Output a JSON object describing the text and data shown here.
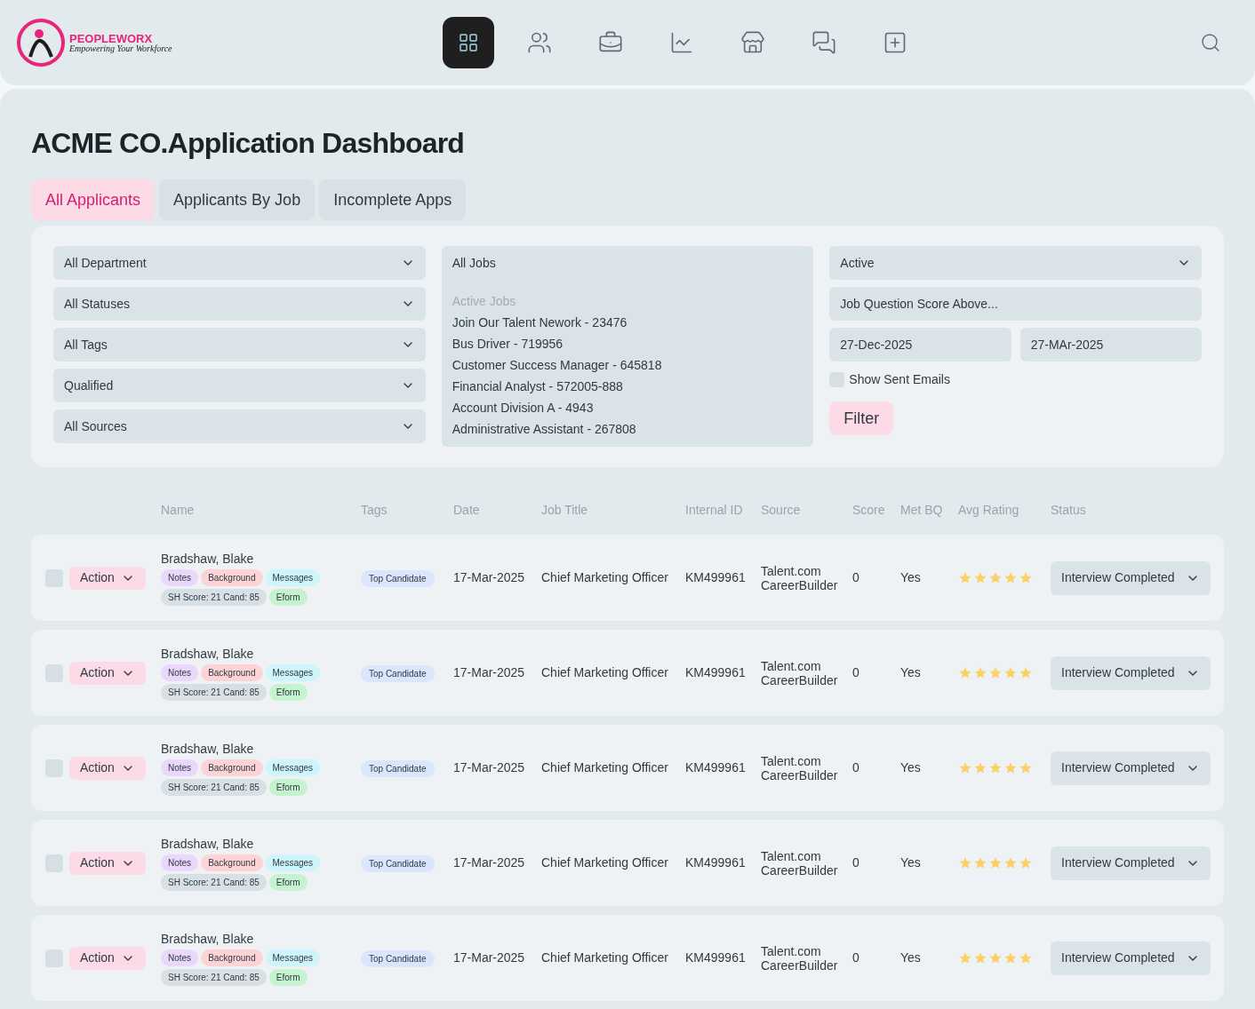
{
  "logo": {
    "name": "PEOPLEWORX",
    "tagline": "Empowering Your Workforce"
  },
  "nav": [
    {
      "kind": "grid",
      "selected": true
    },
    {
      "kind": "users",
      "selected": false
    },
    {
      "kind": "briefcase",
      "selected": false
    },
    {
      "kind": "chart",
      "selected": false
    },
    {
      "kind": "store",
      "selected": false
    },
    {
      "kind": "messages",
      "selected": false
    },
    {
      "kind": "add",
      "selected": false
    }
  ],
  "title": "ACME CO.Application Dashboard",
  "tabs": [
    {
      "label": "All Applicants",
      "selected": true
    },
    {
      "label": "Applicants By Job",
      "selected": false
    },
    {
      "label": "Incomplete Apps",
      "selected": false
    }
  ],
  "filters": {
    "selects": [
      "All Department",
      "All Statuses",
      "All Tags",
      "Qualified",
      "All Sources"
    ],
    "jobs": {
      "value": "All Jobs",
      "group_label": "Active Jobs",
      "options": [
        "Join Our Talent Nework - 23476",
        "Bus Driver - 719956",
        "Customer Success Manager - 645818",
        "Financial Analyst - 572005-888",
        "Account Division A - 4943",
        "Administrative Assistant - 267808"
      ]
    },
    "status": "Active",
    "score_placeholder": "Job Question Score Above...",
    "date_from": "27-Dec-2025",
    "date_to": "27-MAr-2025",
    "show_sent_emails": {
      "label": "Show Sent Emails",
      "checked": false
    },
    "filter_button": "Filter"
  },
  "table": {
    "columns": [
      "Name",
      "Tags",
      "Date",
      "Job Title",
      "Internal ID",
      "Source",
      "Score",
      "Met BQ",
      "Avg Rating",
      "Status"
    ],
    "rows": [
      {
        "checked": false,
        "action": "Action",
        "name": "Bradshaw, Blake",
        "chips": [
          {
            "label": "Notes",
            "color": "#ead7fb"
          },
          {
            "label": "Background",
            "color": "#fed3d6"
          },
          {
            "label": "Messages",
            "color": "#cdf5fb"
          },
          {
            "label": "SH Score: 21 Cand: 85",
            "color": "#d8e0e6"
          },
          {
            "label": "Eform",
            "color": "#c6f3cf"
          }
        ],
        "tag": "Top Candidate",
        "date": "17-Mar-2025",
        "job_title": "Chief Marketing Officer",
        "internal_id": "KM499961",
        "source": [
          "Talent.com",
          "CareerBuilder"
        ],
        "score": "0",
        "met_bq": "Yes",
        "stars": 5,
        "status": "Interview Completed"
      },
      {
        "checked": false,
        "action": "Action",
        "name": "Bradshaw, Blake",
        "chips": [
          {
            "label": "Notes",
            "color": "#ead7fb"
          },
          {
            "label": "Background",
            "color": "#fed3d6"
          },
          {
            "label": "Messages",
            "color": "#cdf5fb"
          },
          {
            "label": "SH Score: 21 Cand: 85",
            "color": "#d8e0e6"
          },
          {
            "label": "Eform",
            "color": "#c6f3cf"
          }
        ],
        "tag": "Top Candidate",
        "date": "17-Mar-2025",
        "job_title": "Chief Marketing Officer",
        "internal_id": "KM499961",
        "source": [
          "Talent.com",
          "CareerBuilder"
        ],
        "score": "0",
        "met_bq": "Yes",
        "stars": 5,
        "status": "Interview Completed"
      },
      {
        "checked": false,
        "action": "Action",
        "name": "Bradshaw, Blake",
        "chips": [
          {
            "label": "Notes",
            "color": "#ead7fb"
          },
          {
            "label": "Background",
            "color": "#fed3d6"
          },
          {
            "label": "Messages",
            "color": "#cdf5fb"
          },
          {
            "label": "SH Score: 21 Cand: 85",
            "color": "#d8e0e6"
          },
          {
            "label": "Eform",
            "color": "#c6f3cf"
          }
        ],
        "tag": "Top Candidate",
        "date": "17-Mar-2025",
        "job_title": "Chief Marketing Officer",
        "internal_id": "KM499961",
        "source": [
          "Talent.com",
          "CareerBuilder"
        ],
        "score": "0",
        "met_bq": "Yes",
        "stars": 5,
        "status": "Interview Completed"
      },
      {
        "checked": false,
        "action": "Action",
        "name": "Bradshaw, Blake",
        "chips": [
          {
            "label": "Notes",
            "color": "#ead7fb"
          },
          {
            "label": "Background",
            "color": "#fed3d6"
          },
          {
            "label": "Messages",
            "color": "#cdf5fb"
          },
          {
            "label": "SH Score: 21 Cand: 85",
            "color": "#d8e0e6"
          },
          {
            "label": "Eform",
            "color": "#c6f3cf"
          }
        ],
        "tag": "Top Candidate",
        "date": "17-Mar-2025",
        "job_title": "Chief Marketing Officer",
        "internal_id": "KM499961",
        "source": [
          "Talent.com",
          "CareerBuilder"
        ],
        "score": "0",
        "met_bq": "Yes",
        "stars": 5,
        "status": "Interview Completed"
      },
      {
        "checked": false,
        "action": "Action",
        "name": "Bradshaw, Blake",
        "chips": [
          {
            "label": "Notes",
            "color": "#ead7fb"
          },
          {
            "label": "Background",
            "color": "#fed3d6"
          },
          {
            "label": "Messages",
            "color": "#cdf5fb"
          },
          {
            "label": "SH Score: 21 Cand: 85",
            "color": "#d8e0e6"
          },
          {
            "label": "Eform",
            "color": "#c6f3cf"
          }
        ],
        "tag": "Top Candidate",
        "date": "17-Mar-2025",
        "job_title": "Chief Marketing Officer",
        "internal_id": "KM499961",
        "source": [
          "Talent.com",
          "CareerBuilder"
        ],
        "score": "0",
        "met_bq": "Yes",
        "stars": 5,
        "status": "Interview Completed"
      }
    ]
  }
}
